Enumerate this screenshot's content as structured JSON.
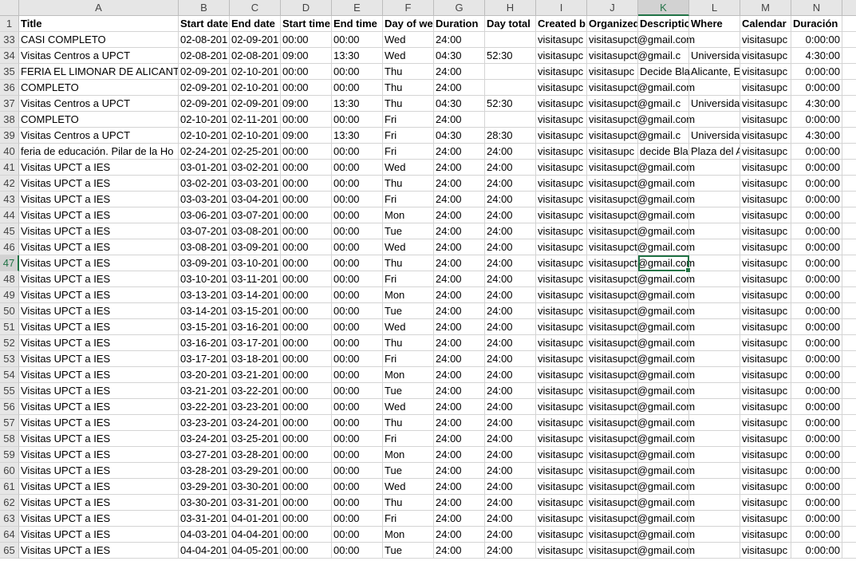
{
  "columns": [
    "A",
    "B",
    "C",
    "D",
    "E",
    "F",
    "G",
    "H",
    "I",
    "J",
    "K",
    "L",
    "M",
    "N"
  ],
  "selected_column": "K",
  "selected_row": "47",
  "header_row": {
    "num": "1",
    "cells": [
      "Title",
      "Start date",
      "End date",
      "Start time",
      "End time",
      "Day of we",
      "Duration",
      "Day total",
      "Created b",
      "Organized",
      "Descriptio",
      "Where",
      "Calendar",
      "Duración"
    ]
  },
  "rows": [
    {
      "num": "33",
      "c": [
        "CASI COMPLETO",
        "02-08-201",
        "02-09-201",
        "00:00",
        "00:00",
        "Wed",
        "24:00",
        "",
        "visitasupc",
        "visitasupct@gmail.com",
        "",
        "",
        "visitasupc",
        "0:00:00"
      ]
    },
    {
      "num": "34",
      "c": [
        "Visitas Centros a UPCT",
        "02-08-201",
        "02-08-201",
        "09:00",
        "13:30",
        "Wed",
        "04:30",
        "52:30",
        "visitasupc",
        "visitasupct@gmail.c",
        "",
        "Universida",
        "visitasupc",
        "4:30:00"
      ]
    },
    {
      "num": "35",
      "c": [
        "FERIA EL LIMONAR DE ALICANTE",
        "02-09-201",
        "02-10-201",
        "00:00",
        "00:00",
        "Thu",
        "24:00",
        "",
        "visitasupc",
        "visitasupc",
        "Decide Bla",
        "Alicante, E",
        "visitasupc",
        "0:00:00"
      ]
    },
    {
      "num": "36",
      "c": [
        "COMPLETO",
        "02-09-201",
        "02-10-201",
        "00:00",
        "00:00",
        "Thu",
        "24:00",
        "",
        "visitasupc",
        "visitasupct@gmail.com",
        "",
        "",
        "visitasupc",
        "0:00:00"
      ]
    },
    {
      "num": "37",
      "c": [
        "Visitas Centros a UPCT",
        "02-09-201",
        "02-09-201",
        "09:00",
        "13:30",
        "Thu",
        "04:30",
        "52:30",
        "visitasupc",
        "visitasupct@gmail.c",
        "",
        "Universida",
        "visitasupc",
        "4:30:00"
      ]
    },
    {
      "num": "38",
      "c": [
        "COMPLETO",
        "02-10-201",
        "02-11-201",
        "00:00",
        "00:00",
        "Fri",
        "24:00",
        "",
        "visitasupc",
        "visitasupct@gmail.com",
        "",
        "",
        "visitasupc",
        "0:00:00"
      ]
    },
    {
      "num": "39",
      "c": [
        "Visitas Centros a UPCT",
        "02-10-201",
        "02-10-201",
        "09:00",
        "13:30",
        "Fri",
        "04:30",
        "28:30",
        "visitasupc",
        "visitasupct@gmail.c",
        "",
        "Universida",
        "visitasupc",
        "4:30:00"
      ]
    },
    {
      "num": "40",
      "c": [
        "feria de educación. Pilar de la Ho",
        "02-24-201",
        "02-25-201",
        "00:00",
        "00:00",
        "Fri",
        "24:00",
        "24:00",
        "visitasupc",
        "visitasupc",
        "decide Bla",
        "Plaza del A",
        "visitasupc",
        "0:00:00"
      ]
    },
    {
      "num": "41",
      "c": [
        "Visitas UPCT a IES",
        "03-01-201",
        "03-02-201",
        "00:00",
        "00:00",
        "Wed",
        "24:00",
        "24:00",
        "visitasupc",
        "visitasupct@gmail.com",
        "",
        "",
        "visitasupc",
        "0:00:00"
      ]
    },
    {
      "num": "42",
      "c": [
        "Visitas UPCT a IES",
        "03-02-201",
        "03-03-201",
        "00:00",
        "00:00",
        "Thu",
        "24:00",
        "24:00",
        "visitasupc",
        "visitasupct@gmail.com",
        "",
        "",
        "visitasupc",
        "0:00:00"
      ]
    },
    {
      "num": "43",
      "c": [
        "Visitas UPCT a IES",
        "03-03-201",
        "03-04-201",
        "00:00",
        "00:00",
        "Fri",
        "24:00",
        "24:00",
        "visitasupc",
        "visitasupct@gmail.com",
        "",
        "",
        "visitasupc",
        "0:00:00"
      ]
    },
    {
      "num": "44",
      "c": [
        "Visitas UPCT a IES",
        "03-06-201",
        "03-07-201",
        "00:00",
        "00:00",
        "Mon",
        "24:00",
        "24:00",
        "visitasupc",
        "visitasupct@gmail.com",
        "",
        "",
        "visitasupc",
        "0:00:00"
      ]
    },
    {
      "num": "45",
      "c": [
        "Visitas UPCT a IES",
        "03-07-201",
        "03-08-201",
        "00:00",
        "00:00",
        "Tue",
        "24:00",
        "24:00",
        "visitasupc",
        "visitasupct@gmail.com",
        "",
        "",
        "visitasupc",
        "0:00:00"
      ]
    },
    {
      "num": "46",
      "c": [
        "Visitas UPCT a IES",
        "03-08-201",
        "03-09-201",
        "00:00",
        "00:00",
        "Wed",
        "24:00",
        "24:00",
        "visitasupc",
        "visitasupct@gmail.com",
        "",
        "",
        "visitasupc",
        "0:00:00"
      ]
    },
    {
      "num": "47",
      "c": [
        "Visitas UPCT a IES",
        "03-09-201",
        "03-10-201",
        "00:00",
        "00:00",
        "Thu",
        "24:00",
        "24:00",
        "visitasupc",
        "visitasupct@gmail.com",
        "",
        "",
        "visitasupc",
        "0:00:00"
      ]
    },
    {
      "num": "48",
      "c": [
        "Visitas UPCT a IES",
        "03-10-201",
        "03-11-201",
        "00:00",
        "00:00",
        "Fri",
        "24:00",
        "24:00",
        "visitasupc",
        "visitasupct@gmail.com",
        "",
        "",
        "visitasupc",
        "0:00:00"
      ]
    },
    {
      "num": "49",
      "c": [
        "Visitas UPCT a IES",
        "03-13-201",
        "03-14-201",
        "00:00",
        "00:00",
        "Mon",
        "24:00",
        "24:00",
        "visitasupc",
        "visitasupct@gmail.com",
        "",
        "",
        "visitasupc",
        "0:00:00"
      ]
    },
    {
      "num": "50",
      "c": [
        "Visitas UPCT a IES",
        "03-14-201",
        "03-15-201",
        "00:00",
        "00:00",
        "Tue",
        "24:00",
        "24:00",
        "visitasupc",
        "visitasupct@gmail.com",
        "",
        "",
        "visitasupc",
        "0:00:00"
      ]
    },
    {
      "num": "51",
      "c": [
        "Visitas UPCT a IES",
        "03-15-201",
        "03-16-201",
        "00:00",
        "00:00",
        "Wed",
        "24:00",
        "24:00",
        "visitasupc",
        "visitasupct@gmail.com",
        "",
        "",
        "visitasupc",
        "0:00:00"
      ]
    },
    {
      "num": "52",
      "c": [
        "Visitas UPCT a IES",
        "03-16-201",
        "03-17-201",
        "00:00",
        "00:00",
        "Thu",
        "24:00",
        "24:00",
        "visitasupc",
        "visitasupct@gmail.com",
        "",
        "",
        "visitasupc",
        "0:00:00"
      ]
    },
    {
      "num": "53",
      "c": [
        "Visitas UPCT a IES",
        "03-17-201",
        "03-18-201",
        "00:00",
        "00:00",
        "Fri",
        "24:00",
        "24:00",
        "visitasupc",
        "visitasupct@gmail.com",
        "",
        "",
        "visitasupc",
        "0:00:00"
      ]
    },
    {
      "num": "54",
      "c": [
        "Visitas UPCT a IES",
        "03-20-201",
        "03-21-201",
        "00:00",
        "00:00",
        "Mon",
        "24:00",
        "24:00",
        "visitasupc",
        "visitasupct@gmail.com",
        "",
        "",
        "visitasupc",
        "0:00:00"
      ]
    },
    {
      "num": "55",
      "c": [
        "Visitas UPCT a IES",
        "03-21-201",
        "03-22-201",
        "00:00",
        "00:00",
        "Tue",
        "24:00",
        "24:00",
        "visitasupc",
        "visitasupct@gmail.com",
        "",
        "",
        "visitasupc",
        "0:00:00"
      ]
    },
    {
      "num": "56",
      "c": [
        "Visitas UPCT a IES",
        "03-22-201",
        "03-23-201",
        "00:00",
        "00:00",
        "Wed",
        "24:00",
        "24:00",
        "visitasupc",
        "visitasupct@gmail.com",
        "",
        "",
        "visitasupc",
        "0:00:00"
      ]
    },
    {
      "num": "57",
      "c": [
        "Visitas UPCT a IES",
        "03-23-201",
        "03-24-201",
        "00:00",
        "00:00",
        "Thu",
        "24:00",
        "24:00",
        "visitasupc",
        "visitasupct@gmail.com",
        "",
        "",
        "visitasupc",
        "0:00:00"
      ]
    },
    {
      "num": "58",
      "c": [
        "Visitas UPCT a IES",
        "03-24-201",
        "03-25-201",
        "00:00",
        "00:00",
        "Fri",
        "24:00",
        "24:00",
        "visitasupc",
        "visitasupct@gmail.com",
        "",
        "",
        "visitasupc",
        "0:00:00"
      ]
    },
    {
      "num": "59",
      "c": [
        "Visitas UPCT a IES",
        "03-27-201",
        "03-28-201",
        "00:00",
        "00:00",
        "Mon",
        "24:00",
        "24:00",
        "visitasupc",
        "visitasupct@gmail.com",
        "",
        "",
        "visitasupc",
        "0:00:00"
      ]
    },
    {
      "num": "60",
      "c": [
        "Visitas UPCT a IES",
        "03-28-201",
        "03-29-201",
        "00:00",
        "00:00",
        "Tue",
        "24:00",
        "24:00",
        "visitasupc",
        "visitasupct@gmail.com",
        "",
        "",
        "visitasupc",
        "0:00:00"
      ]
    },
    {
      "num": "61",
      "c": [
        "Visitas UPCT a IES",
        "03-29-201",
        "03-30-201",
        "00:00",
        "00:00",
        "Wed",
        "24:00",
        "24:00",
        "visitasupc",
        "visitasupct@gmail.com",
        "",
        "",
        "visitasupc",
        "0:00:00"
      ]
    },
    {
      "num": "62",
      "c": [
        "Visitas UPCT a IES",
        "03-30-201",
        "03-31-201",
        "00:00",
        "00:00",
        "Thu",
        "24:00",
        "24:00",
        "visitasupc",
        "visitasupct@gmail.com",
        "",
        "",
        "visitasupc",
        "0:00:00"
      ]
    },
    {
      "num": "63",
      "c": [
        "Visitas UPCT a IES",
        "03-31-201",
        "04-01-201",
        "00:00",
        "00:00",
        "Fri",
        "24:00",
        "24:00",
        "visitasupc",
        "visitasupct@gmail.com",
        "",
        "",
        "visitasupc",
        "0:00:00"
      ]
    },
    {
      "num": "64",
      "c": [
        "Visitas UPCT a IES",
        "04-03-201",
        "04-04-201",
        "00:00",
        "00:00",
        "Mon",
        "24:00",
        "24:00",
        "visitasupc",
        "visitasupct@gmail.com",
        "",
        "",
        "visitasupc",
        "0:00:00"
      ]
    },
    {
      "num": "65",
      "c": [
        "Visitas UPCT a IES",
        "04-04-201",
        "04-05-201",
        "00:00",
        "00:00",
        "Tue",
        "24:00",
        "24:00",
        "visitasupc",
        "visitasupct@gmail.com",
        "",
        "",
        "visitasupc",
        "0:00:00"
      ]
    }
  ]
}
